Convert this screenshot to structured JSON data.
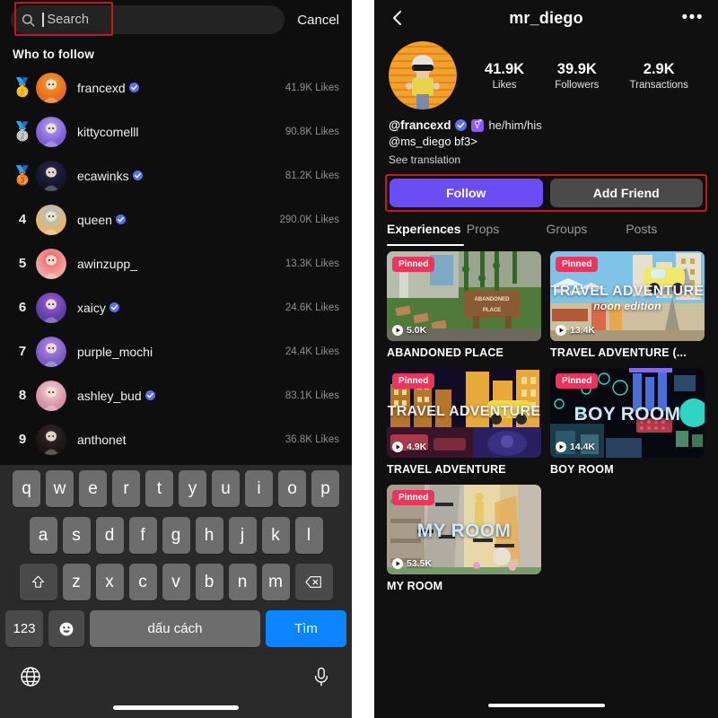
{
  "left": {
    "search": {
      "placeholder": "Search",
      "icon": "search-icon",
      "cancel_label": "Cancel",
      "highlight_color": "#c21a1a"
    },
    "section_title": "Who to follow",
    "follow_list": [
      {
        "rank": "1",
        "medal": "🥇",
        "username": "francexd",
        "verified": true,
        "likes": "41.9K Likes",
        "avatar_colors": [
          "#f0a32a",
          "#e86b1f"
        ]
      },
      {
        "rank": "2",
        "medal": "🥈",
        "username": "kittycomelll",
        "verified": false,
        "likes": "90.8K Likes",
        "avatar_colors": [
          "#b9a6f0",
          "#7f5fd6"
        ]
      },
      {
        "rank": "3",
        "medal": "🥉",
        "username": "ecawinks",
        "verified": true,
        "likes": "81.2K Likes",
        "avatar_colors": [
          "#2b2a4e",
          "#15142b"
        ]
      },
      {
        "rank": "4",
        "medal": "",
        "username": "queen",
        "verified": true,
        "likes": "290.0K Likes",
        "avatar_colors": [
          "#9fc3e8",
          "#e8b56a"
        ]
      },
      {
        "rank": "5",
        "medal": "",
        "username": "awinzupp_",
        "verified": false,
        "likes": "13.3K Likes",
        "avatar_colors": [
          "#e8605f",
          "#f0a2a0"
        ]
      },
      {
        "rank": "6",
        "medal": "",
        "username": "xaicy",
        "verified": true,
        "likes": "24.6K Likes",
        "avatar_colors": [
          "#a95bd6",
          "#5c3fa8"
        ]
      },
      {
        "rank": "7",
        "medal": "",
        "username": "purple_mochi",
        "verified": false,
        "likes": "24.4K Likes",
        "avatar_colors": [
          "#b98de8",
          "#7a5bc4"
        ]
      },
      {
        "rank": "8",
        "medal": "",
        "username": "ashley_bud",
        "verified": true,
        "likes": "83.1K Likes",
        "avatar_colors": [
          "#f0dbd0",
          "#d88fa8"
        ]
      },
      {
        "rank": "9",
        "medal": "",
        "username": "anthonet",
        "verified": false,
        "likes": "36.8K Likes",
        "avatar_colors": [
          "#3a2a2a",
          "#1d1414"
        ]
      }
    ],
    "keyboard": {
      "row1": [
        "q",
        "w",
        "e",
        "r",
        "t",
        "y",
        "u",
        "i",
        "o",
        "p"
      ],
      "row2": [
        "a",
        "s",
        "d",
        "f",
        "g",
        "h",
        "j",
        "k",
        "l"
      ],
      "row3": [
        "z",
        "x",
        "c",
        "v",
        "b",
        "n",
        "m"
      ],
      "shift_icon": "shift-icon",
      "backspace_icon": "backspace-icon",
      "numbers_label": "123",
      "emoji_icon": "emoji-icon",
      "space_label": "dấu cách",
      "search_label": "Tìm",
      "globe_icon": "globe-icon",
      "mic_icon": "microphone-icon",
      "accent_color": "#0b84fe"
    }
  },
  "right": {
    "header": {
      "back_icon": "back-arrow-icon",
      "title": "mr_diego",
      "more_icon": "more-options-icon"
    },
    "profile": {
      "avatar_colors": [
        "#f5c04a",
        "#e8822a"
      ],
      "stats": [
        {
          "value": "41.9K",
          "label": "Likes"
        },
        {
          "value": "39.9K",
          "label": "Followers"
        },
        {
          "value": "2.9K",
          "label": "Transactions"
        }
      ],
      "handle": "@francexd",
      "verified": true,
      "gender_badge": "⚥",
      "pronouns": "he/him/his",
      "bio_line2": "@ms_diego bf3>",
      "see_translation": "See translation"
    },
    "actions": {
      "follow_label": "Follow",
      "add_friend_label": "Add Friend",
      "follow_color": "#6a4df4",
      "add_friend_color": "#4a4a4a",
      "highlight_color": "#c21a1a"
    },
    "tabs": [
      {
        "label": "Experiences",
        "active": true
      },
      {
        "label": "Props",
        "active": false
      },
      {
        "label": "Groups",
        "active": false
      },
      {
        "label": "Posts",
        "active": false
      }
    ],
    "experiences": [
      {
        "pinned_label": "Pinned",
        "plays": "5.0K",
        "title": "ABANDONED PLACE",
        "thumb_overlay_text": "",
        "thumb_sub_text": "",
        "thumb_colors": [
          "#7d8a6b",
          "#3d5234",
          "#9aa48f"
        ],
        "theme": "abandoned"
      },
      {
        "pinned_label": "Pinned",
        "plays": "13.4K",
        "title": "TRAVEL ADVENTURE (...",
        "thumb_overlay_text": "TRAVEL ADVENTURE",
        "thumb_sub_text": "noon edition",
        "thumb_colors": [
          "#7fc4e8",
          "#d8c9a8",
          "#e8d98a"
        ],
        "theme": "travel-day"
      },
      {
        "pinned_label": "Pinned",
        "plays": "4.9K",
        "title": "TRAVEL ADVENTURE",
        "thumb_overlay_text": "TRAVEL ADVENTURE",
        "thumb_sub_text": "",
        "thumb_colors": [
          "#1b1430",
          "#d89a2a",
          "#5a2f6b"
        ],
        "theme": "travel-night"
      },
      {
        "pinned_label": "Pinned",
        "plays": "14.4K",
        "title": "BOY ROOM",
        "thumb_overlay_text": "BOY ROOM",
        "thumb_sub_text": "",
        "thumb_colors": [
          "#0a0a14",
          "#2fd4c4",
          "#4a6fd8"
        ],
        "theme": "boyroom"
      },
      {
        "pinned_label": "Pinned",
        "plays": "53.5K",
        "title": "MY ROOM",
        "thumb_overlay_text": "MY ROOM",
        "thumb_sub_text": "",
        "thumb_colors": [
          "#c9c2b4",
          "#e8c86a",
          "#8f8madd"
        ],
        "theme": "myroom"
      }
    ]
  }
}
